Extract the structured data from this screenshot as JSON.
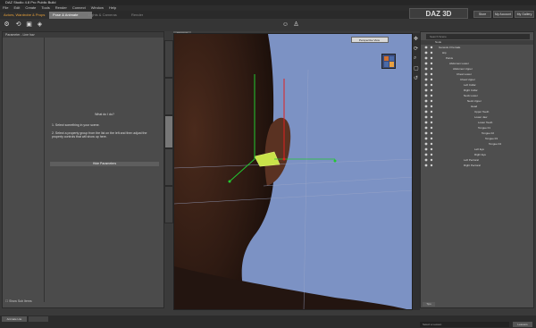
{
  "app": {
    "title": "DAZ Studio 4.8 Pro Public Build",
    "logo": "DAZ 3D"
  },
  "menu": [
    "File",
    "Edit",
    "Create",
    "Tools",
    "Render",
    "Connect",
    "Window",
    "Help"
  ],
  "room_tabs": [
    {
      "label": "Actors, Wardrobe & Props"
    },
    {
      "label": "Pose & Animate"
    },
    {
      "label": "Lights & Cameras"
    },
    {
      "label": "Render"
    }
  ],
  "top_buttons": {
    "store": "Store",
    "account": "My Account",
    "gallery": "My Gallery"
  },
  "left_panel": {
    "header": "Parameter - Line hav",
    "question": "What do I do?",
    "hint1": "1. Select something in your scene.",
    "hint2": "2. Select a property group from the list on the left and then adjust the property controls that will show up here.",
    "params_bar": "Hide Parameters",
    "show_sub": "Show Sub Items"
  },
  "viewport": {
    "tab": "Viewport",
    "camera": "Perspective View"
  },
  "scene": {
    "search_placeholder": "Search Scene",
    "header": "Node",
    "nodes": [
      "Genesis 3 Female",
      "Hip",
      "Pelvis",
      "Abdomen Lower",
      "Abdomen Upper",
      "Chest Lower",
      "Chest Upper",
      "Left Collar",
      "Right Collar",
      "Neck Lower",
      "Neck Upper",
      "Head",
      "Upper Teeth",
      "Lower Jaw",
      "Lower Teeth",
      "Tongue 01",
      "Tongue 02",
      "Tongue 03",
      "Tongue 04",
      "Left Eye",
      "Right Eye",
      "Left Pectoral",
      "Right Pectoral"
    ],
    "tab": "Tips"
  },
  "bottom": {
    "timeline_tab": "Animate Lite",
    "search": "Select a Lesson",
    "tab": "Lessons"
  }
}
